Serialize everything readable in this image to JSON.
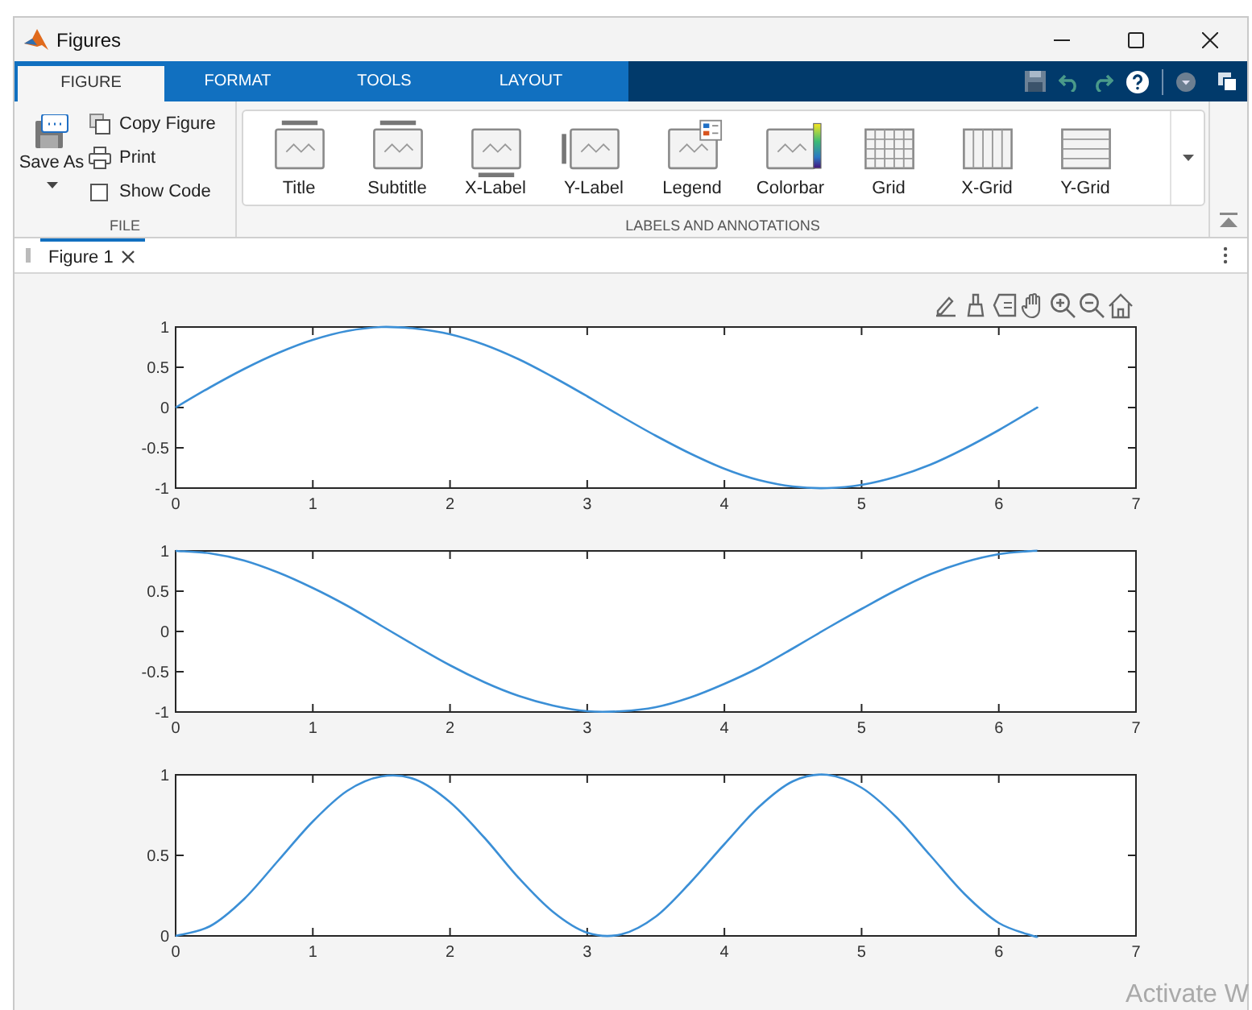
{
  "window": {
    "title": "Figures"
  },
  "ribbon_tabs": [
    {
      "label": "FIGURE",
      "selected": true
    },
    {
      "label": "FORMAT",
      "selected": false
    },
    {
      "label": "TOOLS",
      "selected": false
    },
    {
      "label": "LAYOUT",
      "selected": false
    }
  ],
  "file_section": {
    "label": "FILE",
    "save_as": "Save As",
    "copy_figure": "Copy Figure",
    "print": "Print",
    "show_code": {
      "label": "Show Code",
      "checked": false
    }
  },
  "annotations_section": {
    "label": "LABELS AND ANNOTATIONS",
    "buttons": [
      {
        "label": "Title",
        "kind": "title"
      },
      {
        "label": "Subtitle",
        "kind": "subtitle"
      },
      {
        "label": "X-Label",
        "kind": "xlabel"
      },
      {
        "label": "Y-Label",
        "kind": "ylabel"
      },
      {
        "label": "Legend",
        "kind": "legend"
      },
      {
        "label": "Colorbar",
        "kind": "colorbar"
      },
      {
        "label": "Grid",
        "kind": "grid"
      },
      {
        "label": "X-Grid",
        "kind": "xgrid"
      },
      {
        "label": "Y-Grid",
        "kind": "ygrid"
      }
    ]
  },
  "document_tabs": [
    {
      "label": "Figure 1",
      "selected": true
    }
  ],
  "plots": [
    {
      "chart_data": {
        "type": "line",
        "x": [
          0,
          0.25,
          0.5,
          0.75,
          1,
          1.25,
          1.5,
          1.75,
          2,
          2.25,
          2.5,
          2.75,
          3,
          3.25,
          3.5,
          3.75,
          4,
          4.25,
          4.5,
          4.75,
          5,
          5.25,
          5.5,
          5.75,
          6,
          6.25,
          6.28
        ],
        "series": [
          {
            "color": "#3b8fd6",
            "values": [
              0,
              0.25,
              0.48,
              0.68,
              0.84,
              0.95,
              1,
              0.98,
              0.91,
              0.78,
              0.6,
              0.38,
              0.14,
              -0.11,
              -0.35,
              -0.57,
              -0.76,
              -0.9,
              -0.98,
              -1,
              -0.96,
              -0.86,
              -0.71,
              -0.51,
              -0.28,
              -0.03,
              0
            ]
          }
        ],
        "xlim": [
          0,
          7
        ],
        "ylim": [
          -1,
          1
        ],
        "xticks": [
          0,
          1,
          2,
          3,
          4,
          5,
          6,
          7
        ],
        "yticks": [
          -1,
          -0.5,
          0,
          0.5,
          1
        ]
      }
    },
    {
      "chart_data": {
        "type": "line",
        "x": [
          0,
          0.25,
          0.5,
          0.75,
          1,
          1.25,
          1.5,
          1.75,
          2,
          2.25,
          2.5,
          2.75,
          3,
          3.25,
          3.5,
          3.75,
          4,
          4.25,
          4.5,
          4.75,
          5,
          5.25,
          5.5,
          5.75,
          6,
          6.25,
          6.28
        ],
        "series": [
          {
            "color": "#3b8fd6",
            "values": [
              1,
              0.97,
              0.88,
              0.73,
              0.54,
              0.32,
              0.07,
              -0.18,
              -0.42,
              -0.63,
              -0.8,
              -0.92,
              -0.99,
              -0.99,
              -0.94,
              -0.82,
              -0.65,
              -0.45,
              -0.21,
              0.04,
              0.28,
              0.51,
              0.71,
              0.86,
              0.96,
              1,
              1
            ]
          }
        ],
        "xlim": [
          0,
          7
        ],
        "ylim": [
          -1,
          1
        ],
        "xticks": [
          0,
          1,
          2,
          3,
          4,
          5,
          6,
          7
        ],
        "yticks": [
          -1,
          -0.5,
          0,
          0.5,
          1
        ]
      }
    },
    {
      "chart_data": {
        "type": "line",
        "x": [
          0,
          0.25,
          0.5,
          0.75,
          1,
          1.25,
          1.5,
          1.75,
          2,
          2.25,
          2.5,
          2.75,
          3,
          3.25,
          3.5,
          3.75,
          4,
          4.25,
          4.5,
          4.75,
          5,
          5.25,
          5.5,
          5.75,
          6,
          6.25,
          6.28
        ],
        "series": [
          {
            "color": "#3b8fd6",
            "values": [
              0,
              0.06,
              0.23,
              0.47,
              0.71,
              0.9,
              0.99,
              0.97,
              0.83,
              0.61,
              0.36,
              0.15,
              0.02,
              0.01,
              0.12,
              0.33,
              0.57,
              0.8,
              0.96,
              1,
              0.92,
              0.74,
              0.5,
              0.26,
              0.08,
              0,
              0
            ]
          }
        ],
        "xlim": [
          0,
          7
        ],
        "ylim": [
          0,
          1
        ],
        "xticks": [
          0,
          1,
          2,
          3,
          4,
          5,
          6,
          7
        ],
        "yticks": [
          0,
          0.5,
          1
        ]
      }
    }
  ],
  "activation_notice": {
    "text": "Activate W"
  }
}
